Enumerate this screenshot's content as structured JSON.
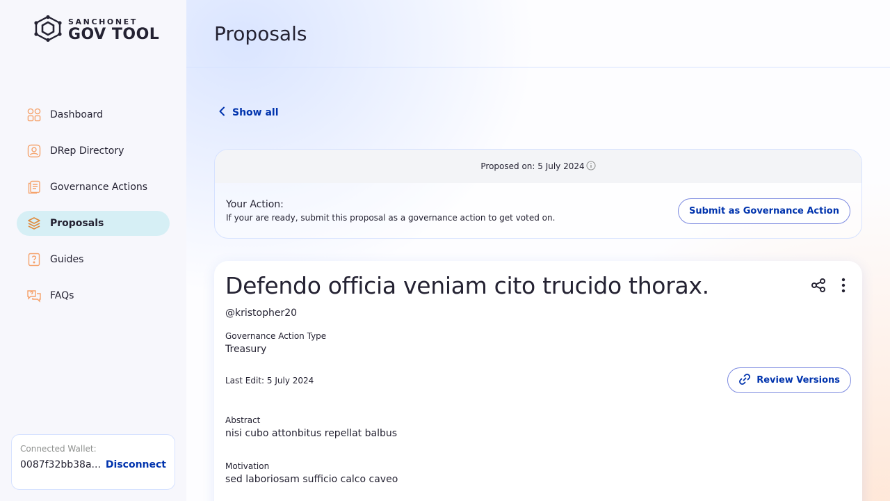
{
  "sidebar": {
    "logo": {
      "small": "SANCHONET",
      "big": "GOV TOOL"
    },
    "items": [
      {
        "label": "Dashboard",
        "icon": "dashboard-icon"
      },
      {
        "label": "DRep Directory",
        "icon": "drep-directory-icon"
      },
      {
        "label": "Governance Actions",
        "icon": "governance-actions-icon"
      },
      {
        "label": "Proposals",
        "icon": "proposals-icon",
        "active": true
      },
      {
        "label": "Guides",
        "icon": "guides-icon"
      },
      {
        "label": "FAQs",
        "icon": "faqs-icon"
      }
    ],
    "wallet": {
      "label": "Connected Wallet:",
      "address": "0087f32bb38a...",
      "disconnect": "Disconnect"
    }
  },
  "header": {
    "title": "Proposals"
  },
  "main": {
    "back_link": "Show all",
    "action_box": {
      "proposed_on": "Proposed on: 5 July 2024",
      "title": "Your Action:",
      "description": "If your are ready, submit this proposal as a governance action to get voted on.",
      "submit_label": "Submit as Governance Action"
    },
    "proposal": {
      "title": "Defendo officia veniam cito trucido thorax.",
      "author": "@kristopher20",
      "type_label": "Governance Action Type",
      "type_value": "Treasury",
      "last_edit": "Last Edit: 5 July 2024",
      "review_label": "Review Versions",
      "abstract_label": "Abstract",
      "abstract_value": "nisi cubo attonbitus repellat balbus",
      "motivation_label": "Motivation",
      "motivation_value": "sed laboriosam sufficio calco caveo"
    }
  },
  "colors": {
    "accent": "#0033ad",
    "nav_active_bg": "#d6eff5",
    "icon_orange": "#f5a26b",
    "border": "#d6e2ff"
  }
}
